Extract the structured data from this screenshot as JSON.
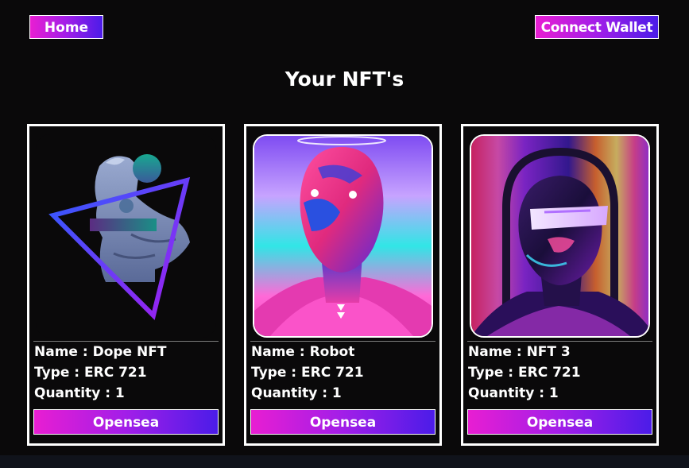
{
  "nav": {
    "home_label": "Home",
    "connect_wallet_label": "Connect Wallet"
  },
  "page": {
    "title": "Your NFT's"
  },
  "cards": [
    {
      "image_icon": "statue-with-triangle-art",
      "name_line": "Name : Dope NFT",
      "type_line": "Type : ERC 721",
      "quantity_line": "Quantity : 1",
      "button_label": "Opensea"
    },
    {
      "image_icon": "robot-head-art",
      "name_line": "Name : Robot",
      "type_line": "Type : ERC 721",
      "quantity_line": "Quantity : 1",
      "button_label": "Opensea"
    },
    {
      "image_icon": "neon-face-art",
      "name_line": "Name : NFT 3",
      "type_line": "Type : ERC 721",
      "quantity_line": "Quantity : 1",
      "button_label": "Opensea"
    }
  ],
  "colors": {
    "background": "#0a090a",
    "button_gradient_start": "#e81ed2",
    "button_gradient_end": "#4b1ce8",
    "card_border": "#ffffff"
  }
}
